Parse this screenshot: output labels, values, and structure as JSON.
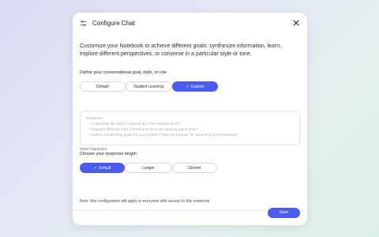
{
  "dialog": {
    "title": "Configure Chat",
    "intro": "Customize your Notebook to achieve different goals: synthesize information, learn, explore different perspectives, or converse in a particular style or tone."
  },
  "goal": {
    "label": "Define your conversational goal, style, or role",
    "options": [
      "Default",
      "Guided Learning",
      "Custom"
    ],
    "selected": "Custom",
    "placeholder": {
      "heading": "Examples:",
      "items": [
        "Customize the style (\"respond at a PhD student level\")",
        "Suggest different roles (\"pretend to be a role-playing game host\")",
        "Define overarching goals for your project (\"help me prepare for upcoming board meeting\")"
      ]
    },
    "char_count": "0/500 characters"
  },
  "length": {
    "label": "Choose your response length",
    "options": [
      "Default",
      "Longer",
      "Shorter"
    ],
    "selected": "Default"
  },
  "note": "Note: this configuration will apply to everyone with access to this notebook.",
  "save_label": "Save",
  "icons": {
    "settings": "tune-icon",
    "close": "close-icon",
    "check": "check-icon"
  },
  "colors": {
    "accent": "#4a5cf0"
  }
}
